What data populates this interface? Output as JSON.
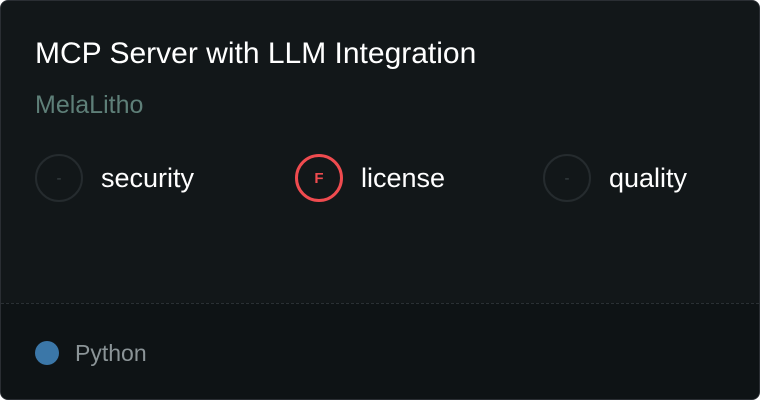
{
  "card": {
    "title": "MCP Server with LLM Integration",
    "owner": "MelaLitho"
  },
  "scores": [
    {
      "grade": "-",
      "label": "security",
      "status": "unrated"
    },
    {
      "grade": "F",
      "label": "license",
      "status": "fail",
      "color": "#ef4b4f"
    },
    {
      "grade": "-",
      "label": "quality",
      "status": "unrated"
    }
  ],
  "footer": {
    "language": "Python",
    "language_color": "#3b77a8"
  }
}
